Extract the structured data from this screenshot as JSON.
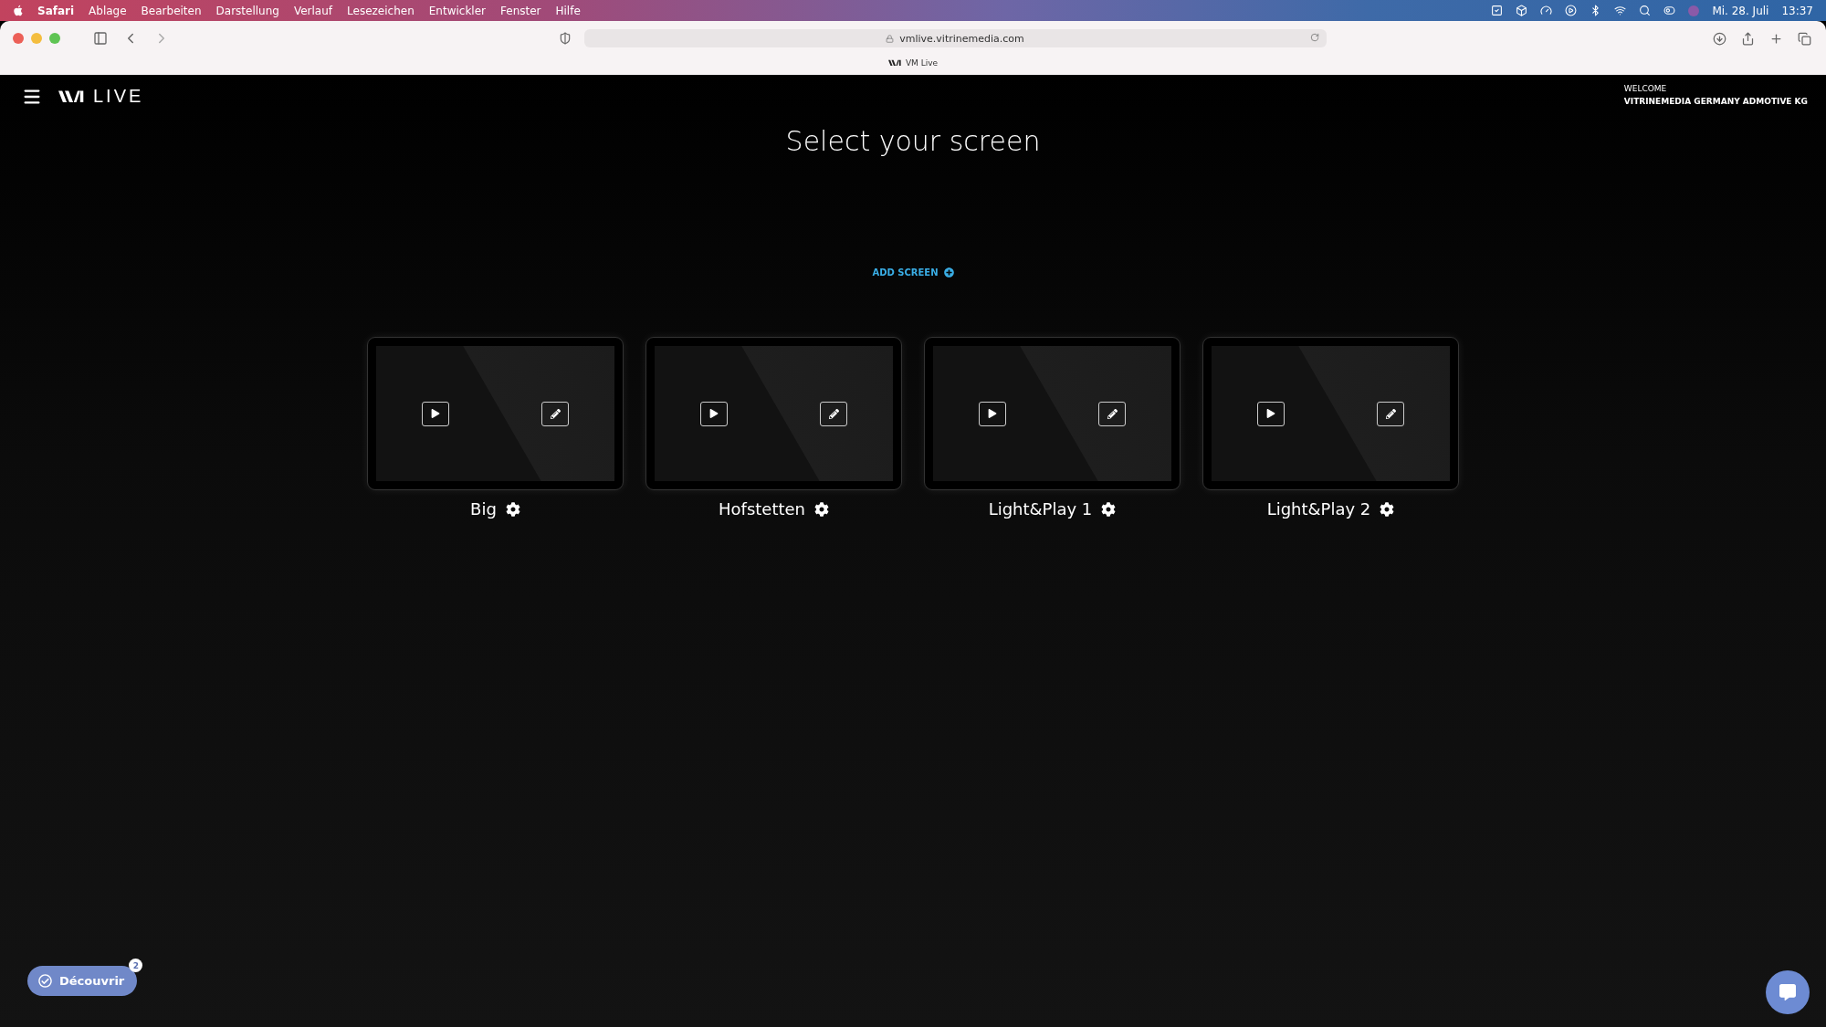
{
  "menu_bar": {
    "app": "Safari",
    "items": [
      "Ablage",
      "Bearbeiten",
      "Darstellung",
      "Verlauf",
      "Lesezeichen",
      "Entwickler",
      "Fenster",
      "Hilfe"
    ],
    "date": "Mi. 28. Juli",
    "time": "13:37"
  },
  "browser": {
    "url": "vmlive.vitrinemedia.com",
    "tab_title": "VM Live"
  },
  "header": {
    "brand": "LIVE",
    "welcome": "WELCOME",
    "company": "VITRINEMEDIA GERMANY ADMOTIVE KG"
  },
  "title": "Select your screen",
  "add_screen": "ADD SCREEN",
  "screens": [
    {
      "name": "Big"
    },
    {
      "name": "Hofstetten"
    },
    {
      "name": "Light&Play 1"
    },
    {
      "name": "Light&Play 2"
    }
  ],
  "discover": {
    "label": "Découvrir",
    "badge": "2"
  }
}
